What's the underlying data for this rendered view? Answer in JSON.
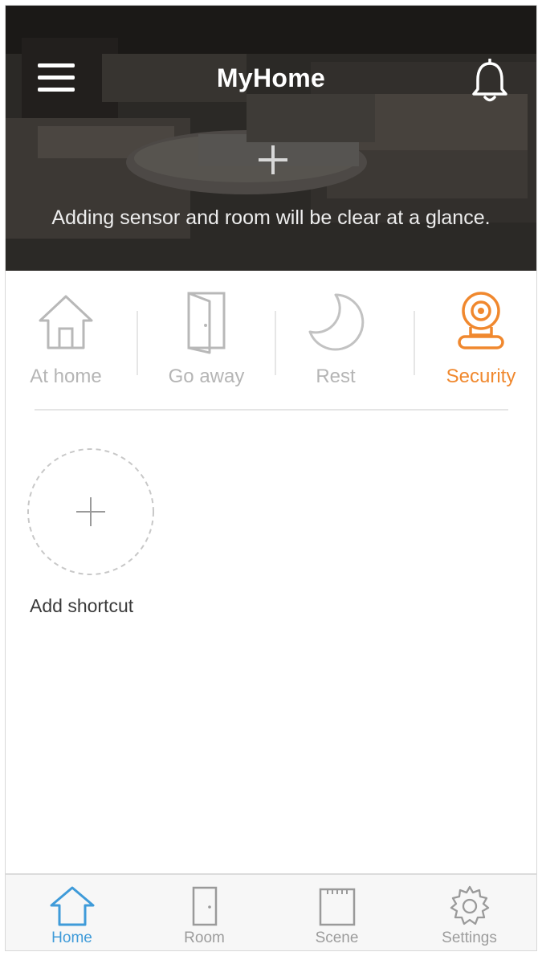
{
  "header": {
    "title": "MyHome",
    "message": "Adding sensor and room will be clear at a glance.",
    "menu_icon": "hamburger-menu-icon",
    "notification_icon": "bell-icon",
    "add_icon": "plus-icon"
  },
  "modes": {
    "active": "Security",
    "accent_color": "#f0882e",
    "inactive_color": "#b5b5b5",
    "items": [
      {
        "label": "At home",
        "icon": "house-icon"
      },
      {
        "label": "Go away",
        "icon": "door-icon"
      },
      {
        "label": "Rest",
        "icon": "moon-icon"
      },
      {
        "label": "Security",
        "icon": "camera-icon"
      }
    ]
  },
  "shortcuts": {
    "add_label": "Add shortcut",
    "add_icon": "plus-icon"
  },
  "tabbar": {
    "active": "Home",
    "active_color": "#3f9bd9",
    "items": [
      {
        "label": "Home",
        "icon": "home-icon"
      },
      {
        "label": "Room",
        "icon": "door-icon"
      },
      {
        "label": "Scene",
        "icon": "scene-icon"
      },
      {
        "label": "Settings",
        "icon": "gear-icon"
      }
    ]
  }
}
